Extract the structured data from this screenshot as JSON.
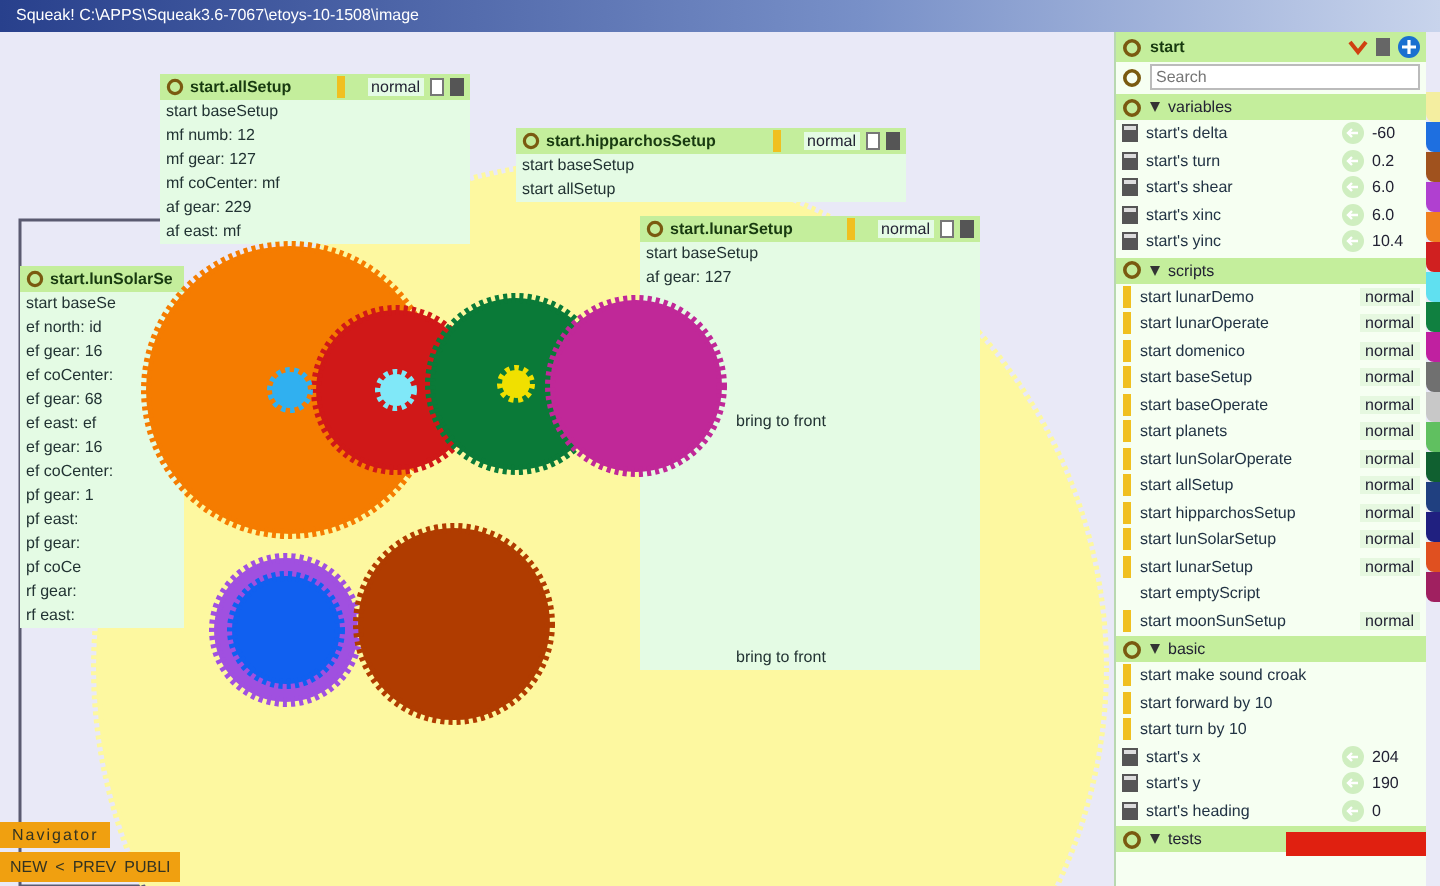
{
  "window": {
    "title": "Squeak! C:\\APPS\\Squeak3.6-7067\\etoys-10-1508\\image"
  },
  "script_windows": [
    {
      "title": "start.allSetup",
      "status": "normal",
      "lines": [
        "start baseSetup",
        "mf numb: 12",
        "mf gear: 127",
        "mf coCenter: mf",
        "af gear: 229",
        "af east: mf"
      ]
    },
    {
      "title": "start.hipparchosSetup",
      "status": "normal",
      "lines": [
        "start baseSetup",
        "start allSetup"
      ]
    },
    {
      "title": "start.lunSolarSe",
      "lines": [
        "start baseSe",
        "ef north: id",
        "ef gear: 16",
        "ef coCenter:",
        "ef gear: 68",
        "ef east: ef",
        "ef gear: 16",
        "ef coCenter:",
        "pf gear: 1",
        "pf east:",
        "pf gear:",
        "pf coCe",
        "rf gear:",
        "rf east:"
      ]
    },
    {
      "title": "start.lunarSetup",
      "status": "normal",
      "lines": [
        "start baseSetup",
        "af gear: 127"
      ],
      "tails": [
        "bring to front",
        "bring to front"
      ]
    }
  ],
  "navigator": {
    "title": "Navigator",
    "buttons": [
      "NEW",
      "<",
      "PREV",
      "PUBLI"
    ]
  },
  "viewer": {
    "title": "start",
    "search": {
      "placeholder": "Search"
    },
    "categories": [
      {
        "name": "variables",
        "rows": [
          {
            "kind": "variable",
            "label": "start's delta",
            "value": "-60"
          },
          {
            "kind": "variable",
            "label": "start's turn",
            "value": "0.2"
          },
          {
            "kind": "variable",
            "label": "start's shear",
            "value": "6.0"
          },
          {
            "kind": "variable",
            "label": "start's xinc",
            "value": "6.0"
          },
          {
            "kind": "variable",
            "label": "start's yinc",
            "value": "10.4"
          }
        ]
      },
      {
        "name": "scripts",
        "rows": [
          {
            "kind": "script",
            "label": "start lunarDemo",
            "status": "normal"
          },
          {
            "kind": "script",
            "label": "start lunarOperate",
            "status": "normal"
          },
          {
            "kind": "script",
            "label": "start domenico",
            "status": "normal"
          },
          {
            "kind": "script",
            "label": "start baseSetup",
            "status": "normal"
          },
          {
            "kind": "script",
            "label": "start baseOperate",
            "status": "normal"
          },
          {
            "kind": "script",
            "label": "start planets",
            "status": "normal"
          },
          {
            "kind": "script",
            "label": "start lunSolarOperate",
            "status": "normal"
          },
          {
            "kind": "script",
            "label": "start allSetup",
            "status": "normal"
          },
          {
            "kind": "script",
            "label": "start hipparchosSetup",
            "status": "normal"
          },
          {
            "kind": "script",
            "label": "start lunSolarSetup",
            "status": "normal"
          },
          {
            "kind": "script",
            "label": "start lunarSetup",
            "status": "normal"
          },
          {
            "kind": "empty",
            "label": "start emptyScript"
          },
          {
            "kind": "script",
            "label": "start moonSunSetup",
            "status": "normal"
          }
        ]
      },
      {
        "name": "basic",
        "rows": [
          {
            "kind": "command",
            "label": "start make sound croak"
          },
          {
            "kind": "command",
            "label": "start forward by 10"
          },
          {
            "kind": "command",
            "label": "start turn by 10"
          },
          {
            "kind": "variable",
            "label": "start's x",
            "value": "204"
          },
          {
            "kind": "variable",
            "label": "start's y",
            "value": "190"
          },
          {
            "kind": "variable",
            "label": "start's heading",
            "value": "0"
          }
        ]
      },
      {
        "name": "tests"
      }
    ]
  },
  "swatches": [
    {
      "color": "#f4eea0"
    },
    {
      "color": "#1e6fe0"
    },
    {
      "color": "#a0521e"
    },
    {
      "color": "#b040d0"
    },
    {
      "color": "#f08020"
    },
    {
      "color": "#d02020"
    },
    {
      "color": "#60e0f0"
    },
    {
      "color": "#108040"
    },
    {
      "color": "#c020a0"
    },
    {
      "color": "#707070"
    },
    {
      "color": "#c8c8c8"
    },
    {
      "color": "#60c060"
    },
    {
      "color": "#106030"
    },
    {
      "color": "#204080"
    },
    {
      "color": "#202080"
    },
    {
      "color": "#e05020"
    },
    {
      "color": "#a02060"
    }
  ]
}
